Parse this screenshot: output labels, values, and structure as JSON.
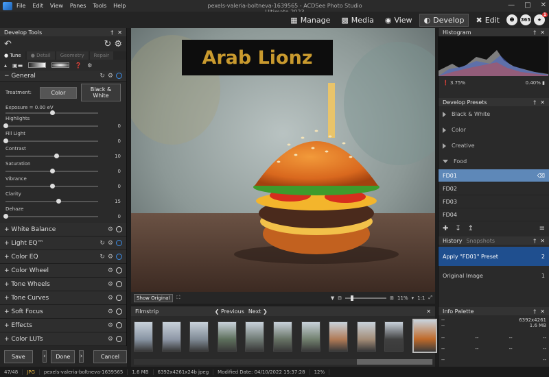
{
  "menubar": {
    "items": [
      "File",
      "Edit",
      "View",
      "Panes",
      "Tools",
      "Help"
    ],
    "window_title": "pexels-valeria-boltneva-1639565 - ACDSee Photo Studio Ultimate 2023"
  },
  "modes": [
    {
      "label": "Manage",
      "icon": "grid-icon"
    },
    {
      "label": "Media",
      "icon": "film-icon"
    },
    {
      "label": "View",
      "icon": "eye-icon"
    },
    {
      "label": "Develop",
      "icon": "develop-icon",
      "active": true
    },
    {
      "label": "Edit",
      "icon": "scissors-icon"
    }
  ],
  "mode_extras": {
    "b365": "365",
    "badge": "1"
  },
  "develop_tools": {
    "title": "Develop Tools",
    "tabs": [
      "Tune",
      "Detail",
      "Geometry",
      "Repair"
    ],
    "general_title": "General",
    "treatment_label": "Treatment:",
    "color_btn": "Color",
    "bw_btn": "Black & White",
    "sliders": [
      {
        "label": "Exposure = 0.00 eV",
        "value": "",
        "pos": 0.5
      },
      {
        "label": "Highlights",
        "value": "0",
        "pos": 0.0
      },
      {
        "label": "Fill Light",
        "value": "0",
        "pos": 0.0
      },
      {
        "label": "Contrast",
        "value": "10",
        "pos": 0.55
      },
      {
        "label": "Saturation",
        "value": "0",
        "pos": 0.5
      },
      {
        "label": "Vibrance",
        "value": "0",
        "pos": 0.5
      },
      {
        "label": "Clarity",
        "value": "15",
        "pos": 0.57
      },
      {
        "label": "Dehaze",
        "value": "0",
        "pos": 0.0
      }
    ],
    "sections": [
      "White Balance",
      "Light EQ™",
      "Color EQ",
      "Color Wheel",
      "Tone Wheels",
      "Tone Curves",
      "Soft Focus",
      "Effects",
      "Color LUTs"
    ],
    "footer": {
      "save": "Save",
      "done": "Done",
      "cancel": "Cancel"
    }
  },
  "viewer": {
    "watermark": "Arab Lionz",
    "show_original": "Show Original",
    "zoom": "11%",
    "ratio": "1:1"
  },
  "filmstrip": {
    "title": "Filmstrip",
    "prev": "Previous",
    "next": "Next",
    "thumb_count": 11
  },
  "histogram": {
    "title": "Histogram",
    "left_pct": "3.75%",
    "right_pct": "0.40%"
  },
  "presets": {
    "title": "Develop Presets",
    "categories": [
      "Black & White",
      "Color",
      "Creative",
      "Food"
    ],
    "items": [
      "FD01",
      "FD02",
      "FD03",
      "FD04"
    ],
    "selected": "FD01"
  },
  "history": {
    "tabs": [
      "History",
      "Snapshots"
    ],
    "items": [
      {
        "label": "Apply \"FD01\" Preset",
        "num": "2"
      },
      {
        "label": "Original Image",
        "num": "1"
      }
    ]
  },
  "info": {
    "title": "Info Palette",
    "dims": "6392x4261",
    "size": "1.6 MB",
    "dashes": "--"
  },
  "status": {
    "index": "47/48",
    "format": "JPG",
    "filename": "pexels-valeria-boltneva-1639565",
    "size": "1.6 MB",
    "dims": "6392x4261x24b jpeg",
    "modified": "Modified Date: 04/10/2022 15:37:28",
    "zoom": "12%"
  },
  "colors": {
    "accent": "#3d8ee8",
    "selection": "#5e88b8",
    "history_sel": "#1f4f8f",
    "watermark_gold": "#c99a2e"
  }
}
